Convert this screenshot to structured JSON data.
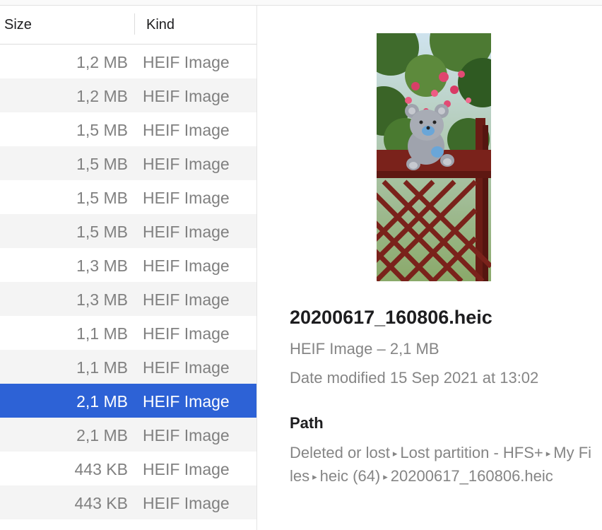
{
  "list": {
    "columns": {
      "size": "Size",
      "kind": "Kind"
    },
    "rows": [
      {
        "size": "1,2 MB",
        "kind": "HEIF Image"
      },
      {
        "size": "1,2 MB",
        "kind": "HEIF Image"
      },
      {
        "size": "1,5 MB",
        "kind": "HEIF Image"
      },
      {
        "size": "1,5 MB",
        "kind": "HEIF Image"
      },
      {
        "size": "1,5 MB",
        "kind": "HEIF Image"
      },
      {
        "size": "1,5 MB",
        "kind": "HEIF Image"
      },
      {
        "size": "1,3 MB",
        "kind": "HEIF Image"
      },
      {
        "size": "1,3 MB",
        "kind": "HEIF Image"
      },
      {
        "size": "1,1 MB",
        "kind": "HEIF Image"
      },
      {
        "size": "1,1 MB",
        "kind": "HEIF Image"
      },
      {
        "size": "2,1 MB",
        "kind": "HEIF Image"
      },
      {
        "size": "2,1 MB",
        "kind": "HEIF Image"
      },
      {
        "size": "443 KB",
        "kind": "HEIF Image"
      },
      {
        "size": "443 KB",
        "kind": "HEIF Image"
      }
    ],
    "selected_index": 10,
    "colors": {
      "selection": "#2d62d6",
      "alt_row": "#f4f4f4",
      "secondary_text": "#808080"
    }
  },
  "preview": {
    "thumbnail_icon": "photo-teddy-bear-on-fence",
    "file_name": "20200617_160806.heic",
    "kind_size": "HEIF Image – 2,1 MB",
    "date_label": "Date modified",
    "date_value": "15 Sep 2021 at 13:02",
    "path_title": "Path",
    "path_parts": [
      "Deleted or lost",
      "Lost partition - HFS+",
      "My Files",
      "heic (64)",
      "20200617_160806.heic"
    ],
    "path_separator": "▸"
  }
}
